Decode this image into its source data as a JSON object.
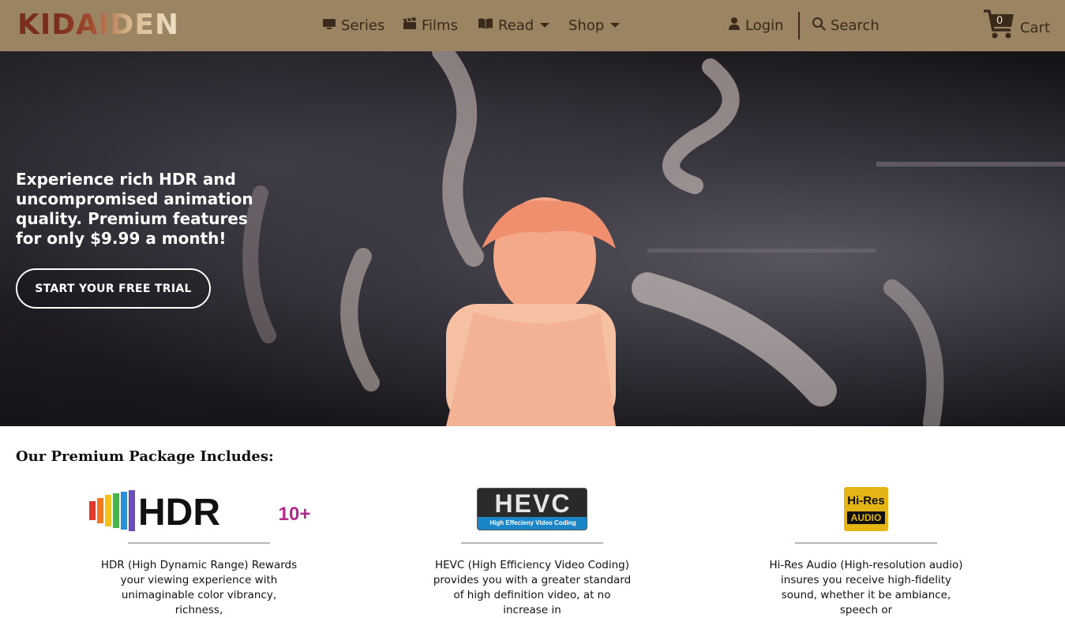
{
  "brand": {
    "logo_text": "KIDAIDEN",
    "colors": {
      "nav_bg": "#9b8462",
      "nav_text": "#3a2a1b",
      "logo_dark": "#7a2e1c",
      "logo_light": "#f0e2c9",
      "hero_text": "#ffffff"
    }
  },
  "nav": {
    "items": [
      {
        "label": "Series",
        "icon": "tv-icon"
      },
      {
        "label": "Films",
        "icon": "clapperboard-icon"
      },
      {
        "label": "Read",
        "icon": "book-icon",
        "has_dropdown": true
      },
      {
        "label": "Shop",
        "has_dropdown": true
      }
    ],
    "login": {
      "label": "Login",
      "icon": "user-icon"
    },
    "search": {
      "label": "Search",
      "icon": "search-icon"
    },
    "cart": {
      "label": "Cart",
      "count": "0",
      "icon": "cart-icon"
    }
  },
  "hero": {
    "headline": "Experience rich HDR and uncompromised animation quality. Premium features for only $9.99 a month!",
    "cta_label": "START YOUR FREE TRIAL"
  },
  "package": {
    "title": "Our Premium Package Includes:",
    "features": [
      {
        "logo": "hdr10plus-logo",
        "logo_text": "HDR10+",
        "description": "HDR (High Dynamic Range) Rewards your viewing experience with unimaginable color vibrancy, richness,"
      },
      {
        "logo": "hevc-logo",
        "logo_text": "HEVC",
        "logo_subtext": "High Effecieny Video Coding",
        "description": "HEVC (High Efficiency Video Coding) provides you with a greater standard of high definition video, at no increase in"
      },
      {
        "logo": "hires-audio-logo",
        "logo_text": "Hi-Res",
        "logo_subtext": "AUDIO",
        "description": "Hi-Res Audio (High-resolution audio) insures you receive high-fidelity sound, whether it be ambiance, speech or"
      }
    ]
  }
}
